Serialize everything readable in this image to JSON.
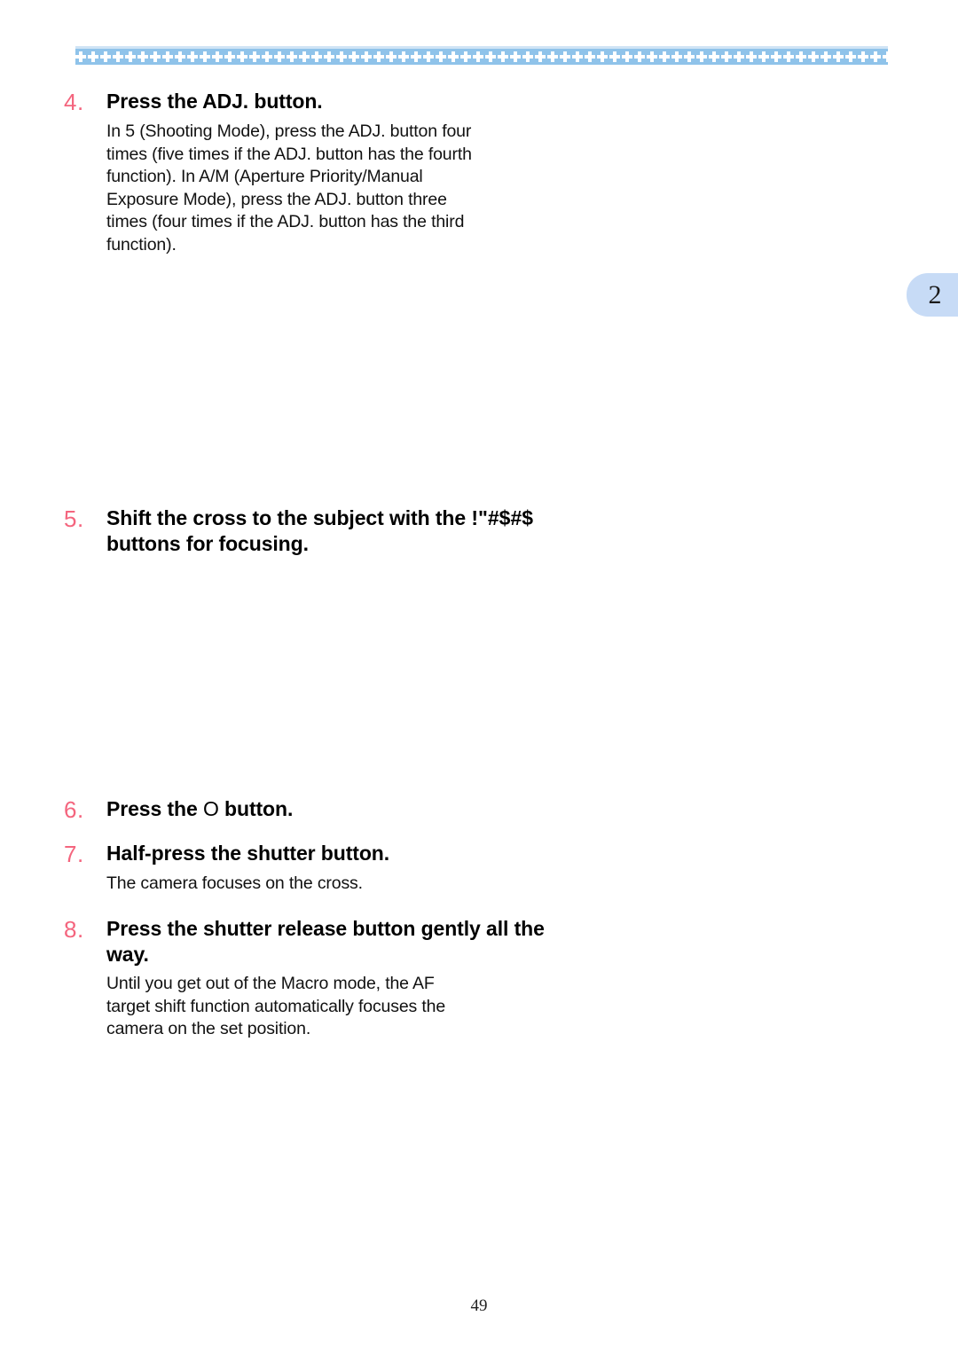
{
  "page": {
    "number": "49",
    "chapter_tab": "2"
  },
  "banner": {
    "motif_name": "diamond-cluster",
    "motif_count": 66,
    "background_color": "#8fc3ea",
    "motif_color": "#ffffff"
  },
  "colors": {
    "step_number": "#f4657e",
    "banner_blue": "#8fc3ea",
    "tab_blue": "#c7dbf6",
    "text": "#000000"
  },
  "steps": [
    {
      "number": "4.",
      "heading": "Press the ADJ. button.",
      "body": "In 5   (Shooting Mode), press the ADJ. button four times (five times if the ADJ. button has the fourth function). In A/M (Aperture Priority/Manual Exposure Mode), press the ADJ. button three times (four times if the ADJ. button has the third function)."
    },
    {
      "number": "5.",
      "heading_part1": "Shift the cross to the subject with the ",
      "heading_glyphs": "!\"#$#$",
      "heading_part2": "   buttons for focusing.",
      "body": ""
    },
    {
      "number": "6.",
      "heading_part1": "Press the ",
      "heading_glyphs": "O",
      "heading_part2": "   button.",
      "body": ""
    },
    {
      "number": "7.",
      "heading": "Half-press the shutter button.",
      "body": "The camera focuses on the cross."
    },
    {
      "number": "8.",
      "heading": "Press the shutter release button gently all the way.",
      "body": "Until you get out of the Macro mode, the AF target shift function automatically focuses the camera on the set position."
    }
  ]
}
